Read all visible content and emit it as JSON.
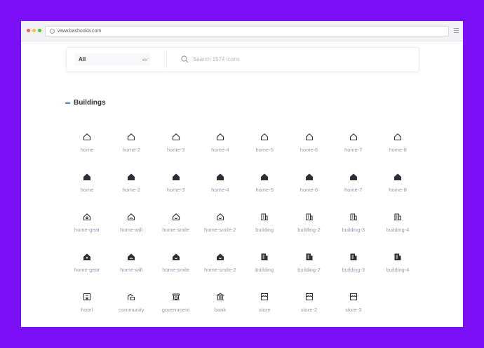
{
  "browser": {
    "url": "www.bashooka.com",
    "dot_colors": [
      "#f25f58",
      "#fbbe3c",
      "#3ec840"
    ]
  },
  "filter": {
    "category": "All",
    "search_placeholder": "Search 1574 Icons"
  },
  "section": {
    "title": "Buildings",
    "accent": "#3f87f5"
  },
  "icons": [
    {
      "name": "home",
      "icon": "house-outline-icon"
    },
    {
      "name": "home-2",
      "icon": "house-outline-icon"
    },
    {
      "name": "home-3",
      "icon": "house-outline-icon"
    },
    {
      "name": "home-4",
      "icon": "house-outline-icon"
    },
    {
      "name": "home-5",
      "icon": "house-outline-icon"
    },
    {
      "name": "home-6",
      "icon": "house-outline-icon"
    },
    {
      "name": "home-7",
      "icon": "house-outline-icon"
    },
    {
      "name": "home-8",
      "icon": "house-outline-icon"
    },
    {
      "name": "home",
      "icon": "house-fill-icon"
    },
    {
      "name": "home-2",
      "icon": "house-fill-icon"
    },
    {
      "name": "home-3",
      "icon": "house-fill-icon"
    },
    {
      "name": "home-4",
      "icon": "house-fill-icon"
    },
    {
      "name": "home-5",
      "icon": "house-fill-icon"
    },
    {
      "name": "home-6",
      "icon": "house-fill-icon"
    },
    {
      "name": "home-7",
      "icon": "house-fill-icon"
    },
    {
      "name": "home-8",
      "icon": "house-fill-icon"
    },
    {
      "name": "home-gear",
      "icon": "home-gear-outline-icon"
    },
    {
      "name": "home-wifi",
      "icon": "home-wifi-outline-icon"
    },
    {
      "name": "home-smile",
      "icon": "home-smile-outline-icon"
    },
    {
      "name": "home-smile-2",
      "icon": "home-smile-outline-icon"
    },
    {
      "name": "building",
      "icon": "building-outline-icon"
    },
    {
      "name": "building-2",
      "icon": "building-outline-icon"
    },
    {
      "name": "building-3",
      "icon": "building-outline-icon"
    },
    {
      "name": "building-4",
      "icon": "building-outline-icon"
    },
    {
      "name": "home-gear",
      "icon": "home-gear-fill-icon"
    },
    {
      "name": "home-wifi",
      "icon": "home-wifi-fill-icon"
    },
    {
      "name": "home-smile",
      "icon": "home-smile-fill-icon"
    },
    {
      "name": "home-smile-2",
      "icon": "home-smile-fill-icon"
    },
    {
      "name": "building",
      "icon": "building-fill-icon"
    },
    {
      "name": "building-2",
      "icon": "building-fill-icon"
    },
    {
      "name": "building-3",
      "icon": "building-fill-icon"
    },
    {
      "name": "building-4",
      "icon": "building-fill-icon"
    },
    {
      "name": "hotel",
      "icon": "hotel-outline-icon"
    },
    {
      "name": "community",
      "icon": "community-outline-icon"
    },
    {
      "name": "government",
      "icon": "government-outline-icon"
    },
    {
      "name": "bank",
      "icon": "bank-outline-icon"
    },
    {
      "name": "store",
      "icon": "store-outline-icon"
    },
    {
      "name": "store-2",
      "icon": "store-outline-icon"
    },
    {
      "name": "store-3",
      "icon": "store-outline-icon"
    }
  ]
}
